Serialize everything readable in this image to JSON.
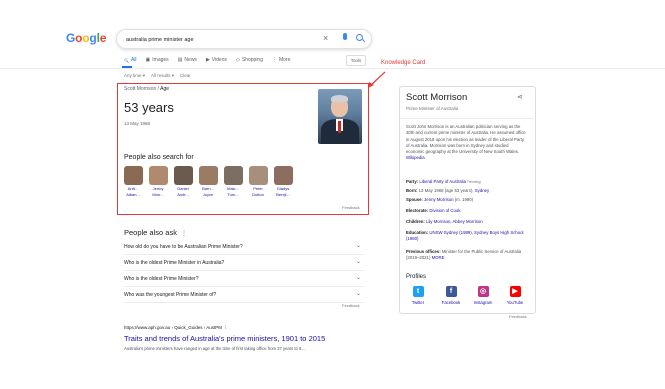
{
  "logo": {
    "letters": [
      "G",
      "o",
      "o",
      "g",
      "l",
      "e"
    ],
    "colors": [
      "#4285F4",
      "#EA4335",
      "#FBBC05",
      "#4285F4",
      "#34A853",
      "#EA4335"
    ]
  },
  "search": {
    "value": "australia prime minister age",
    "clear_icon": "close-icon",
    "voice_icon": "mic-icon",
    "search_icon": "search-icon"
  },
  "tabs": [
    {
      "label": "All",
      "icon": "🔍"
    },
    {
      "label": "Images",
      "icon": "▣"
    },
    {
      "label": "News",
      "icon": "▤"
    },
    {
      "label": "Videos",
      "icon": "▶"
    },
    {
      "label": "Shopping",
      "icon": "◇"
    },
    {
      "label": "More",
      "icon": "⋮"
    }
  ],
  "tools_label": "Tools",
  "filters": [
    "Any time ▾",
    "All results ▾",
    "Clear"
  ],
  "annotation": {
    "label": "Knowledge Card",
    "color": "#e53935"
  },
  "answer": {
    "breadcrumb_name": "Scott Morrison",
    "breadcrumb_sep": "/",
    "breadcrumb_attr": "Age",
    "value": "53 years",
    "dob": "13 May 1968"
  },
  "people_heading": "People also search for",
  "people": [
    {
      "line1": "Antt...",
      "line2": "Alban...",
      "color": "#8a6a55"
    },
    {
      "line1": "Jenny",
      "line2": "Morr...",
      "color": "#b08a6e"
    },
    {
      "line1": "Daniel",
      "line2": "Andr...",
      "color": "#6b5a4e"
    },
    {
      "line1": "Barn...",
      "line2": "Joyce",
      "color": "#9b7b63"
    },
    {
      "line1": "Malc...",
      "line2": "Turn...",
      "color": "#7d6d62"
    },
    {
      "line1": "Peter",
      "line2": "Dutton",
      "color": "#a88f7c"
    },
    {
      "line1": "Gladys",
      "line2": "Berejl...",
      "color": "#8c6d5f"
    }
  ],
  "feedback": "Feedback",
  "paa": {
    "title": "People also ask",
    "more": "⋮",
    "questions": [
      "How old do you have to be Australian Prime Minister?",
      "Who is the oldest Prime Minister in Australia?",
      "Who is the oldest Prime Minister?",
      "Who was the youngest Prime Minister of?"
    ]
  },
  "result": {
    "url": "https://www.aph.gov.au › Quick_Guides › AustPM   ⋮",
    "title": "Traits and trends of Australia's prime ministers, 1901 to 2015",
    "snippet": "Australia's prime ministers have ranged in age at the time of first taking office from 37 years to 6..."
  },
  "panel": {
    "name": "Scott Morrison",
    "subtitle": "Prime Minister of Australia",
    "description": "Scott John Morrison is an Australian politician serving as the 30th and current prime minister of Australia. He assumed office in August 2018 upon his election as leader of the Liberal Party of Australia. Morrison was born in Sydney and studied economic geography at the University of New South Wales.",
    "desc_link": "Wikipedia",
    "facts": [
      {
        "label": "Party:",
        "value": "Liberal Party of Australia",
        "extra": " Trending",
        "link": true
      },
      {
        "label": "Born:",
        "value": "13 May 1968 (age 53 years),",
        "extra": " Sydney",
        "link": false
      },
      {
        "label": "Spouse:",
        "value": "Jenny Morrison",
        "extra": " (m. 1990)",
        "link": true
      },
      {
        "label": "Electorate:",
        "value": "Division of Cook",
        "extra": "",
        "link": true
      },
      {
        "label": "Children:",
        "value": "Lily Morrison, Abbey Morrison",
        "extra": "",
        "link": true
      },
      {
        "label": "Education:",
        "value": "UNSW Sydney (1989), Sydney Boys High School (1980)",
        "extra": "",
        "link": true
      },
      {
        "label": "Previous offices:",
        "value": "Minister for the Public Service of Australia (2019–2021)",
        "extra": " MORE",
        "link": false
      }
    ],
    "profiles_heading": "Profiles",
    "profiles": [
      {
        "label": "Twitter",
        "glyph": "t",
        "color": "#1DA1F2"
      },
      {
        "label": "Facebook",
        "glyph": "f",
        "color": "#3b5998"
      },
      {
        "label": "Instagram",
        "glyph": "◎",
        "color": "#c13584"
      },
      {
        "label": "YouTube",
        "glyph": "▶",
        "color": "#FF0000"
      }
    ]
  }
}
